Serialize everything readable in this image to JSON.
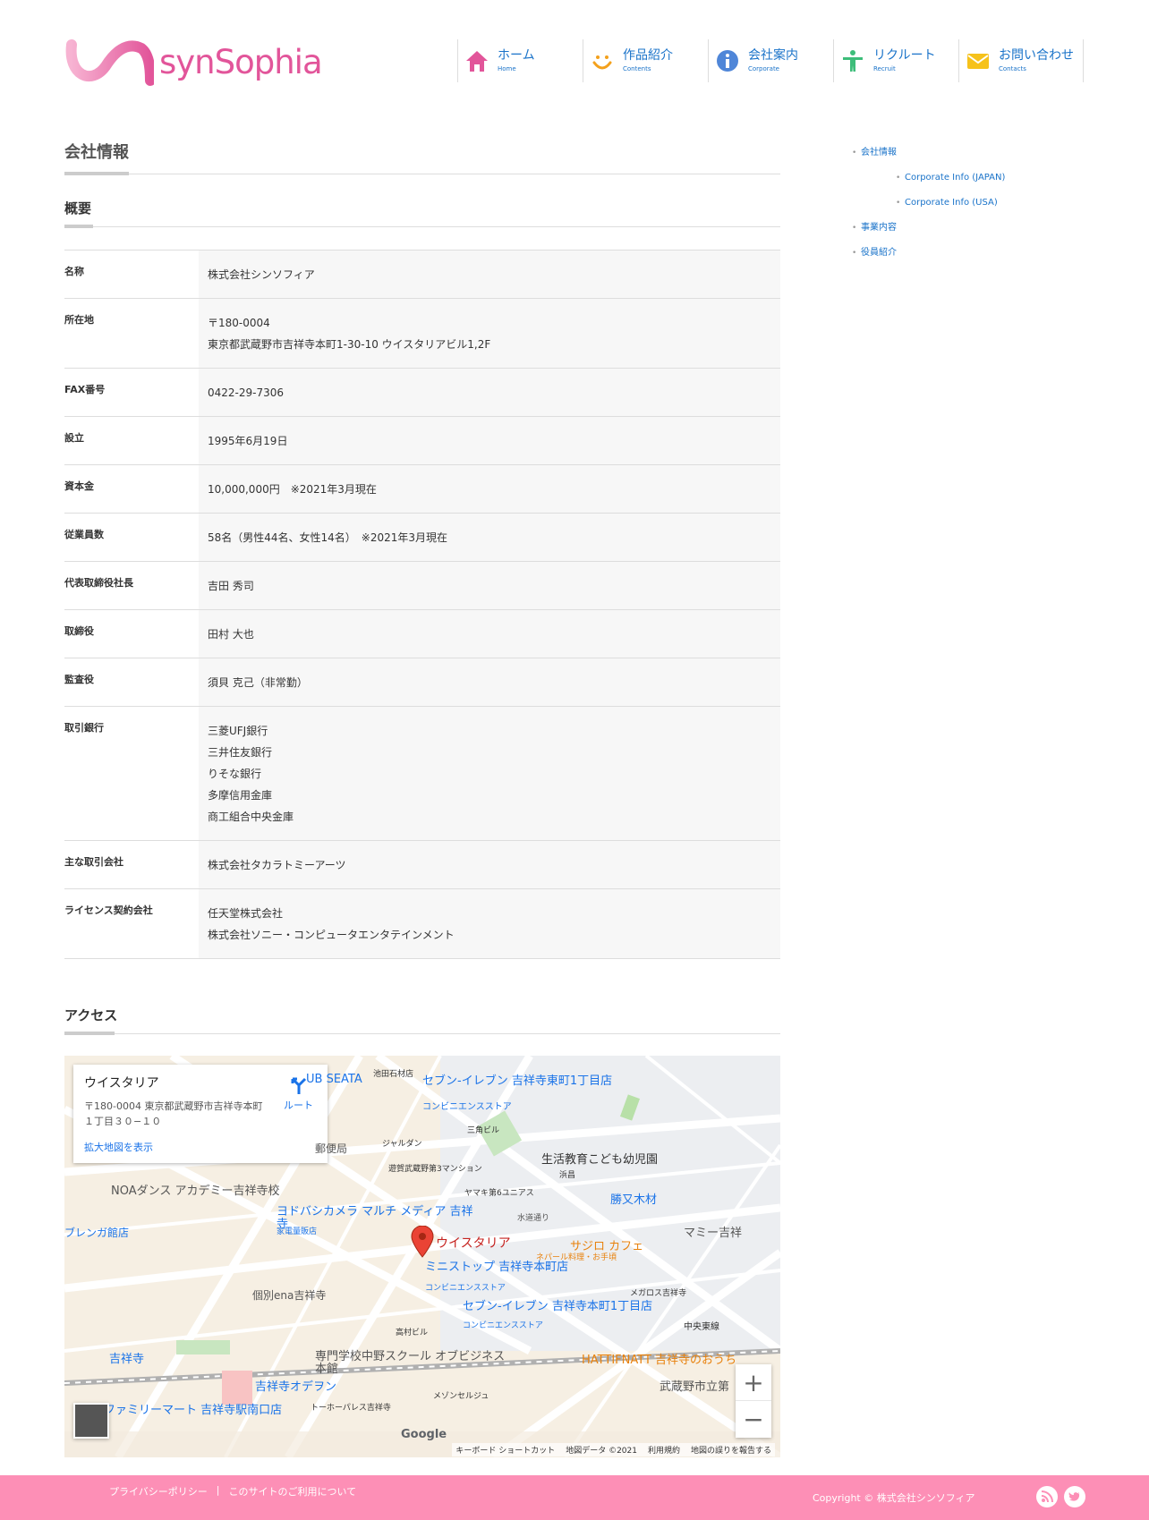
{
  "header": {
    "logo_text": "synSophia",
    "nav": [
      {
        "label": "ホーム",
        "sub": "Home",
        "icon": "home-icon",
        "color": "#e2559a"
      },
      {
        "label": "作品紹介",
        "sub": "Contents",
        "icon": "smile-icon",
        "color": "#f4a11c"
      },
      {
        "label": "会社案内",
        "sub": "Corporate",
        "icon": "info-icon",
        "color": "#4f86d8"
      },
      {
        "label": "リクルート",
        "sub": "Recruit",
        "icon": "person-icon",
        "color": "#3dbd7a"
      },
      {
        "label": "お問い合わせ",
        "sub": "Contacts",
        "icon": "mail-icon",
        "color": "#f6c21b"
      }
    ]
  },
  "main": {
    "page_title": "会社情報",
    "overview_title": "概要",
    "rows": [
      {
        "label": "名称",
        "values": [
          "株式会社シンソフィア"
        ]
      },
      {
        "label": "所在地",
        "values": [
          "〒180-0004",
          "東京都武蔵野市吉祥寺本町1-30-10 ウイスタリアビル1,2F"
        ]
      },
      {
        "label": "FAX番号",
        "values": [
          "0422-29-7306"
        ]
      },
      {
        "label": "設立",
        "values": [
          "1995年6月19日"
        ]
      },
      {
        "label": "資本金",
        "values": [
          "10,000,000円　※2021年3月現在"
        ]
      },
      {
        "label": "従業員数",
        "values": [
          "58名（男性44名、女性14名）　※2021年3月現在"
        ]
      },
      {
        "label": "代表取締役社長",
        "values": [
          "吉田 秀司"
        ]
      },
      {
        "label": "取締役",
        "values": [
          "田村 大也"
        ]
      },
      {
        "label": "監査役",
        "values": [
          "須貝 克己（非常勤）"
        ]
      },
      {
        "label": "取引銀行",
        "values": [
          "三菱UFJ銀行",
          "三井住友銀行",
          "りそな銀行",
          "多摩信用金庫",
          "商工組合中央金庫"
        ]
      },
      {
        "label": "主な取引会社",
        "values": [
          "株式会社タカラトミーアーツ"
        ]
      },
      {
        "label": "ライセンス契約会社",
        "values": [
          "任天堂株式会社",
          "株式会社ソニー・コンピュータエンタテインメント"
        ]
      }
    ],
    "access_title": "アクセス",
    "map": {
      "card_title": "ウイスタリア",
      "card_addr": "〒180-0004 東京都武蔵野市吉祥寺本町１丁目３０−１０",
      "card_link": "拡大地図を表示",
      "route_label": "ルート",
      "pin_label": "ウイスタリア",
      "places": [
        "セブン-イレブン 吉祥寺東町1丁目店",
        "コンビニエンスストア",
        "UB SEATA",
        "池田石材店",
        "ジャルダン",
        "三角ビル",
        "生活教育こども幼児園",
        "浜昌",
        "勝又木材",
        "NOAダンス アカデミー吉祥寺校",
        "ヨドバシカメラ マルチ メディア 吉祥寺",
        "家電量販店",
        "ヤマキ第6ユニアス",
        "マミー吉祥",
        "サジロ カフェ",
        "ネパール料理・お手頃",
        "ミニストップ 吉祥寺本町店",
        "コンビニエンスストア",
        "個別ena吉祥寺",
        "メガロス吉祥寺",
        "セブン-イレブン 吉祥寺本町1丁目店",
        "コンビニエンスストア",
        "中央東線",
        "高村ビル",
        "吉祥寺",
        "専門学校中野スクール オブビジネス本館",
        "HATTIFNATT 吉祥寺のおうち",
        "吉祥寺オデヲン",
        "武蔵野市立第",
        "ファミリーマート 吉祥寺駅南口店",
        "トーホーパレス吉祥寺",
        "メゾンセルジュ",
        "ブレンガ館店",
        "郵便局",
        "遊賀武蔵野第3マンション",
        "水道通り"
      ],
      "zoom_in": "+",
      "zoom_out": "−",
      "google": "Google",
      "footer": [
        "キーボード ショートカット",
        "地図データ ©2021",
        "利用規約",
        "地図の誤りを報告する"
      ]
    }
  },
  "sidebar": {
    "items": [
      {
        "label": "会社情報",
        "sub": false
      },
      {
        "label": "Corporate Info (JAPAN)",
        "sub": true
      },
      {
        "label": "Corporate Info (USA)",
        "sub": true
      },
      {
        "label": "事業内容",
        "sub": false
      },
      {
        "label": "役員紹介",
        "sub": false
      }
    ]
  },
  "footer": {
    "links": [
      "プライバシーポリシー",
      "|",
      "このサイトのご利用について"
    ],
    "copyright": "Copyright ©  株式会社シンソフィア",
    "social": [
      "rss-icon",
      "twitter-icon"
    ],
    "bg_color": "#fd8fb6"
  }
}
